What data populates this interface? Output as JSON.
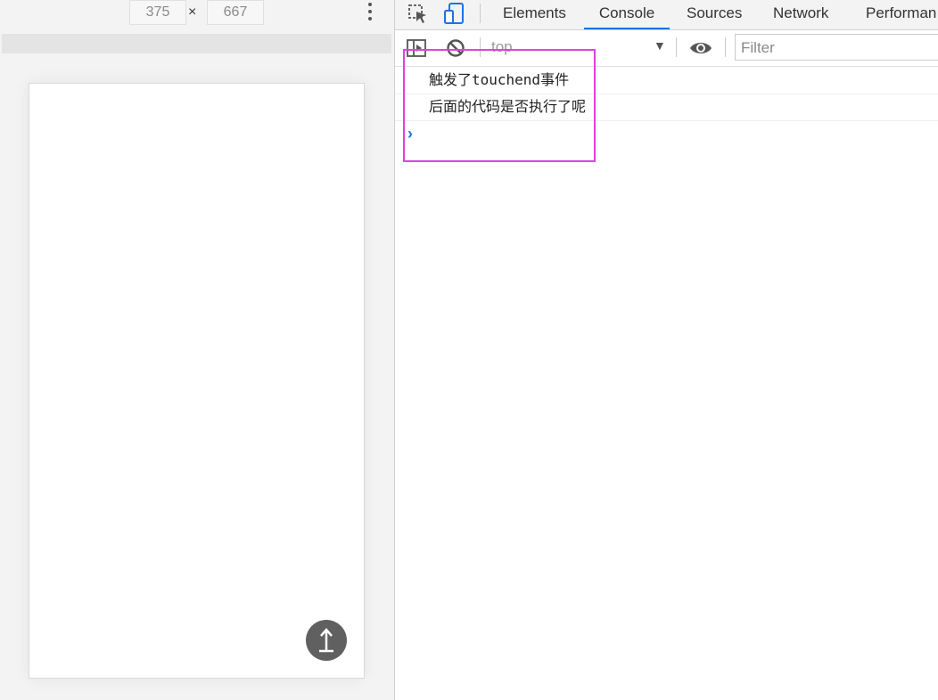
{
  "device_toolbar": {
    "width": "375",
    "times": "×",
    "height": "667"
  },
  "tabs": [
    {
      "label": "Elements"
    },
    {
      "label": "Console"
    },
    {
      "label": "Sources"
    },
    {
      "label": "Network"
    },
    {
      "label": "Performan"
    }
  ],
  "console": {
    "context": "top",
    "context_arrow": "▼",
    "filter_placeholder": "Filter",
    "messages": [
      "触发了touchend事件",
      "后面的代码是否执行了呢"
    ],
    "prompt": "›"
  },
  "colors": {
    "accent": "#1a73e8",
    "highlight": "#e040e0",
    "fab": "#606060"
  }
}
